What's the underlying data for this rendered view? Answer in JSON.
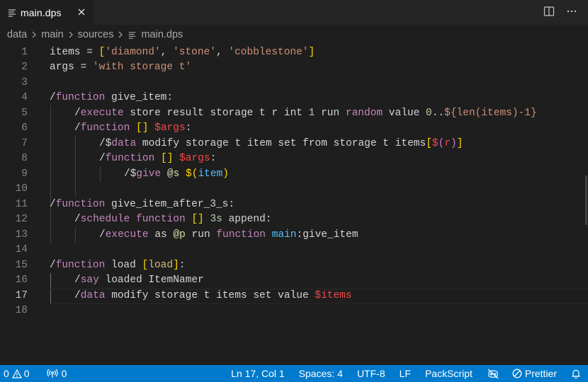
{
  "tab": {
    "label": "main.dps",
    "icon": "file-lines-icon"
  },
  "tab_actions": [
    {
      "name": "split-editor-icon"
    },
    {
      "name": "more-actions-icon"
    }
  ],
  "breadcrumb": [
    {
      "label": "data"
    },
    {
      "label": "main"
    },
    {
      "label": "sources"
    },
    {
      "label": "main.dps",
      "icon": "file-lines-icon"
    }
  ],
  "editor": {
    "active_line": 17,
    "lines": [
      {
        "n": "1"
      },
      {
        "n": "2"
      },
      {
        "n": "3"
      },
      {
        "n": "4"
      },
      {
        "n": "5"
      },
      {
        "n": "6"
      },
      {
        "n": "7"
      },
      {
        "n": "8"
      },
      {
        "n": "9"
      },
      {
        "n": "10"
      },
      {
        "n": "11"
      },
      {
        "n": "12"
      },
      {
        "n": "13"
      },
      {
        "n": "14"
      },
      {
        "n": "15"
      },
      {
        "n": "16"
      },
      {
        "n": "17"
      },
      {
        "n": "18"
      }
    ],
    "code": {
      "l1": [
        "items = ",
        "[",
        "'diamond'",
        ", ",
        "'stone'",
        ", ",
        "'cobblestone'",
        "]"
      ],
      "l2": [
        "args = ",
        "'with storage t'"
      ],
      "l4": [
        "/",
        "function",
        " give_item:"
      ],
      "l5": [
        "/",
        "execute",
        " store result storage t r int ",
        "1",
        " run ",
        "random",
        " value ",
        "0",
        "..",
        "${len(items)-1}"
      ],
      "l6": [
        "/",
        "function",
        " ",
        "[]",
        " ",
        "$args",
        ":"
      ],
      "l7": [
        "/$",
        "data",
        " modify storage t item set from storage t items",
        "[",
        "$",
        "(",
        "r",
        ")",
        "]"
      ],
      "l8": [
        "/",
        "function",
        " ",
        "[]",
        " ",
        "$args",
        ":"
      ],
      "l9": [
        "/$",
        "give",
        " ",
        "@s",
        " ",
        "$",
        "(",
        "item",
        ")"
      ],
      "l11": [
        "/",
        "function",
        " give_item_after_3_s:"
      ],
      "l12": [
        "/",
        "schedule",
        " ",
        "function",
        " ",
        "[]",
        " ",
        "3s",
        " append:"
      ],
      "l13": [
        "/",
        "execute",
        " as ",
        "@p",
        " run ",
        "function",
        " ",
        "main",
        ":give_item"
      ],
      "l15": [
        "/",
        "function",
        " load ",
        "[",
        "load",
        "]",
        ":"
      ],
      "l16": [
        "/",
        "say",
        " loaded ItemNamer"
      ],
      "l17": [
        "/",
        "data",
        " modify storage t items set value ",
        "$items"
      ]
    }
  },
  "status": {
    "errors": "0",
    "warnings": "0",
    "ports": "0",
    "position": "Ln 17, Col 1",
    "spaces": "Spaces: 4",
    "encoding": "UTF-8",
    "eol": "LF",
    "language": "PackScript",
    "prettier": "Prettier"
  },
  "colors": {
    "statusbar": "#007acc",
    "keyword": "#c586c0",
    "string": "#ce9178",
    "bracket_gold": "#ffd700",
    "bracket_orchid": "#da70d6",
    "bracket_blue": "#179fff",
    "macro_var": "#f44747"
  }
}
